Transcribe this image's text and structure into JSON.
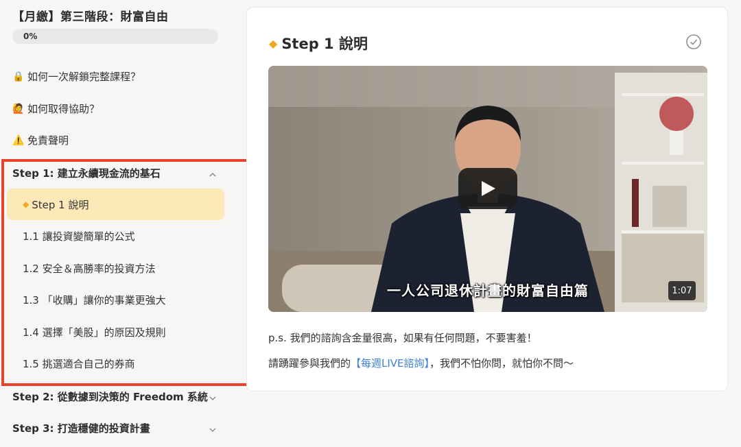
{
  "sidebar": {
    "course_title": "【月繳】第三階段：財富自由",
    "progress_label": "0%",
    "progress_value": 0,
    "links": [
      {
        "icon": "lock-icon",
        "glyph": "🔒",
        "label": "如何一次解鎖完整課程？"
      },
      {
        "icon": "raised-hand-icon",
        "glyph": "🙋",
        "label": "如何取得協助？"
      },
      {
        "icon": "warning-icon",
        "glyph": "⚠️",
        "label": "免責聲明"
      }
    ],
    "sections": [
      {
        "label": "Step 1: 建立永續現金流的基石",
        "expanded": true
      },
      {
        "label": "Step 2: 從數據到決策的 Freedom 系統",
        "expanded": false
      },
      {
        "label": "Step 3: 打造穩健的投資計畫",
        "expanded": false
      }
    ],
    "lessons": [
      {
        "label": "Step 1 說明",
        "active": true
      },
      {
        "label": "1.1 讓投資變簡單的公式",
        "active": false
      },
      {
        "label": "1.2 安全＆高勝率的投資方法",
        "active": false
      },
      {
        "label": "1.3 「收購」讓你的事業更強大",
        "active": false
      },
      {
        "label": "1.4 選擇「美股」的原因及規則",
        "active": false
      },
      {
        "label": "1.5 挑選適合自己的券商",
        "active": false
      }
    ]
  },
  "main": {
    "title": "Step 1 說明",
    "video": {
      "subtitle": "一人公司退休計畫的財富自由篇",
      "duration": "1:07"
    },
    "paragraph1": "p.s. 我們的諮詢含金量很高，如果有任何問題，不要害羞！",
    "paragraph2_prefix": "請踴躍參與我們的",
    "paragraph2_link": "【每週LIVE諮詢】",
    "paragraph2_suffix": "，我們不怕你問，就怕你不問～"
  },
  "colors": {
    "active_lesson_bg": "#fde9b8",
    "diamond": "#f2a61f",
    "highlight_box": "#e8412c",
    "link": "#3b82d6"
  }
}
